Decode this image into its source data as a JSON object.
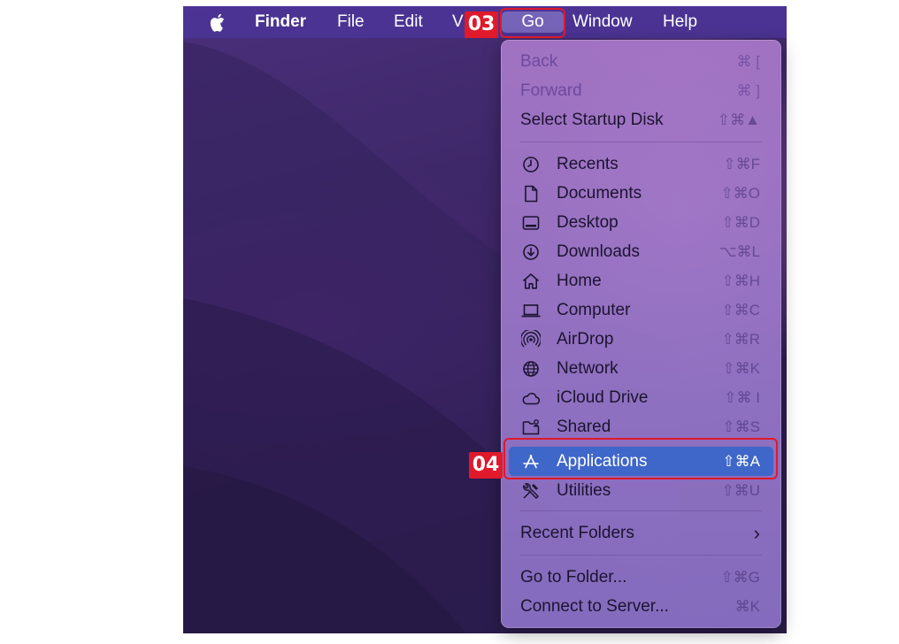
{
  "menubar": {
    "items": [
      {
        "label": "Finder"
      },
      {
        "label": "File"
      },
      {
        "label": "Edit"
      },
      {
        "label": "V"
      },
      {
        "label": "Go"
      },
      {
        "label": "Window"
      },
      {
        "label": "Help"
      }
    ]
  },
  "callouts": {
    "step1": "03",
    "step2": "04"
  },
  "go_menu": {
    "items": [
      {
        "label": "Back",
        "shortcut": "⌘ [",
        "enabled": false
      },
      {
        "label": "Forward",
        "shortcut": "⌘ ]",
        "enabled": false
      },
      {
        "label": "Select Startup Disk",
        "shortcut": "⇧⌘▲"
      },
      {
        "label": "Recents",
        "shortcut": "⇧⌘F",
        "icon": "clock-icon"
      },
      {
        "label": "Documents",
        "shortcut": "⇧⌘O",
        "icon": "document-icon"
      },
      {
        "label": "Desktop",
        "shortcut": "⇧⌘D",
        "icon": "desktop-icon"
      },
      {
        "label": "Downloads",
        "shortcut": "⌥⌘L",
        "icon": "download-icon"
      },
      {
        "label": "Home",
        "shortcut": "⇧⌘H",
        "icon": "home-icon"
      },
      {
        "label": "Computer",
        "shortcut": "⇧⌘C",
        "icon": "laptop-icon"
      },
      {
        "label": "AirDrop",
        "shortcut": "⇧⌘R",
        "icon": "airdrop-icon"
      },
      {
        "label": "Network",
        "shortcut": "⇧⌘K",
        "icon": "globe-icon"
      },
      {
        "label": "iCloud Drive",
        "shortcut": "⇧⌘ I",
        "icon": "cloud-icon"
      },
      {
        "label": "Shared",
        "shortcut": "⇧⌘S",
        "icon": "shared-folder-icon"
      },
      {
        "label": "Applications",
        "shortcut": "⇧⌘A",
        "icon": "applications-icon",
        "selected": true
      },
      {
        "label": "Utilities",
        "shortcut": "⇧⌘U",
        "icon": "utilities-icon"
      },
      {
        "label": "Recent Folders",
        "submenu": true,
        "icon": "chevron-right-icon"
      },
      {
        "label": "Go to Folder...",
        "shortcut": "⇧⌘G"
      },
      {
        "label": "Connect to Server...",
        "shortcut": "⌘K"
      }
    ]
  },
  "colors": {
    "selection": "#3f66c9",
    "callout": "#e0192b",
    "menubar": "#4c3496"
  }
}
